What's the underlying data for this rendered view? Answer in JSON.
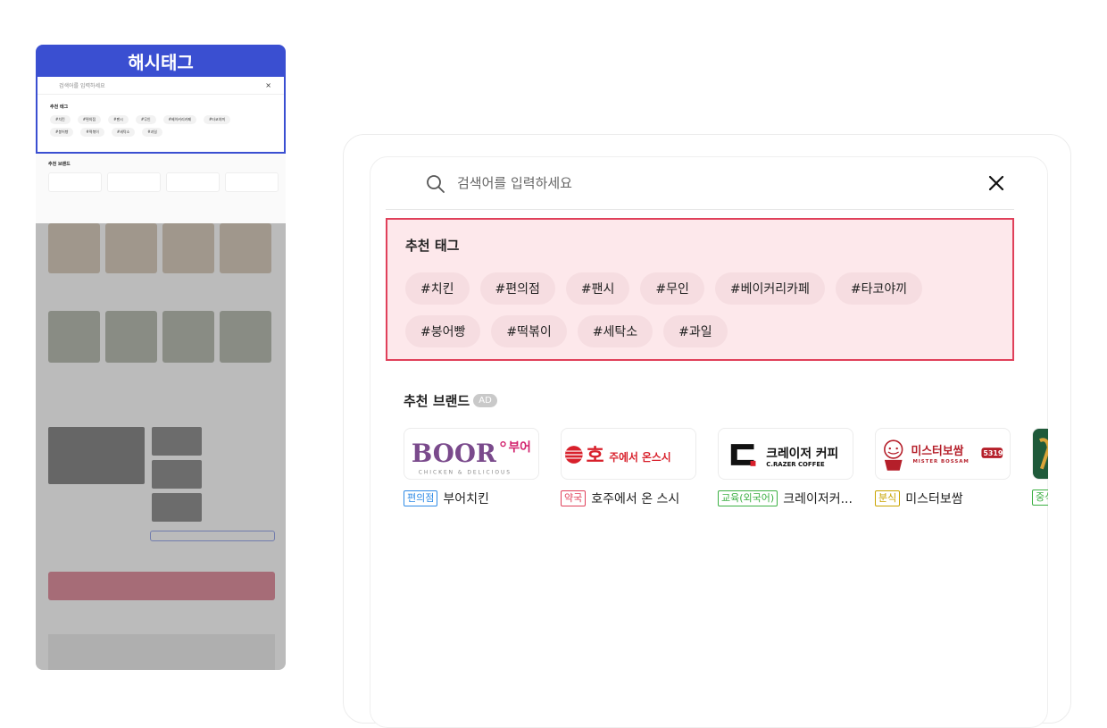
{
  "thumbnail": {
    "header_title": "해시태그",
    "search_placeholder": "검색어를 입력하세요",
    "close_glyph": "×",
    "rec_title": "추천 태그",
    "tags": [
      "#치킨",
      "#편의점",
      "#팬시",
      "#무인",
      "#베이커리카페",
      "#타코야끼",
      "#붕어빵",
      "#떡볶이",
      "#세탁소",
      "#과일"
    ],
    "brand_title": "추천 브랜드"
  },
  "search": {
    "placeholder": "검색어를 입력하세요",
    "icon": "search-icon",
    "close_icon": "close-icon"
  },
  "recommended_tags": {
    "title": "추천 태그",
    "tags": [
      "#치킨",
      "#편의점",
      "#팬시",
      "#무인",
      "#베이커리카페",
      "#타코야끼",
      "#붕어빵",
      "#떡볶이",
      "#세탁소",
      "#과일"
    ],
    "highlight_border": "#e0405a",
    "highlight_fill": "#fde8eb"
  },
  "recommended_brands": {
    "title": "추천 브랜드",
    "ad_label": "AD",
    "brands": [
      {
        "category": "편의점",
        "category_color": "#2f8be6",
        "name": "부어치킨",
        "logo_main": "BOOR",
        "logo_sub": "부어",
        "logo_tag": "CHICKEN & DELICIOUS"
      },
      {
        "category": "약국",
        "category_color": "#e0405a",
        "name": "호주에서 온 스시",
        "logo_main": "호",
        "logo_sub": "주에서 온스시"
      },
      {
        "category": "교육(외국어)",
        "category_color": "#3cb043",
        "name": "크레이저커...",
        "logo_main": "C.",
        "logo_sub": "크레이저 커피",
        "logo_tag": "C.RAZER COFFEE"
      },
      {
        "category": "분식",
        "category_color": "#c9a400",
        "name": "미스터보쌈",
        "logo_main": "미스터보쌈",
        "logo_tag": "MISTER BOSSAM",
        "logo_num": "5319"
      },
      {
        "category": "중식",
        "category_color": "#3cb043",
        "name": ""
      }
    ]
  }
}
